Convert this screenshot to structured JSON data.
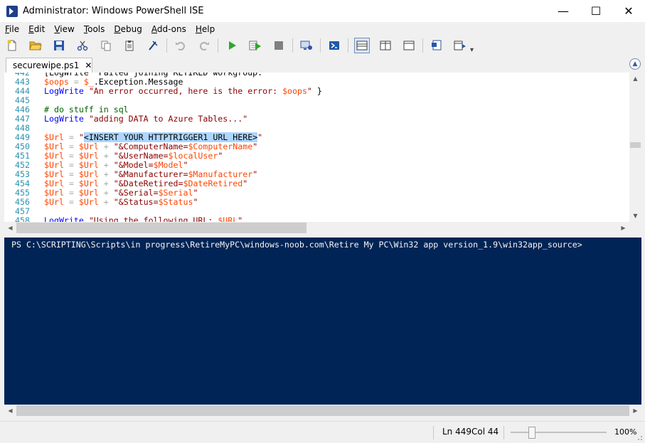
{
  "window": {
    "title": "Administrator: Windows PowerShell ISE",
    "minimize": "—",
    "maximize": "☐",
    "close": "✕"
  },
  "menu": [
    "File",
    "Edit",
    "View",
    "Tools",
    "Debug",
    "Add-ons",
    "Help"
  ],
  "toolbar": {
    "buttons": [
      "new-script",
      "open",
      "save",
      "cut",
      "copy",
      "paste",
      "clear-console",
      "undo",
      "redo",
      "run-script",
      "run-selection",
      "stop",
      "new-remote-tab",
      "start-powershell",
      "show-script-top",
      "show-script-right",
      "show-script-maximized",
      "show-commands",
      "show-command-addon"
    ],
    "overflow": "▾"
  },
  "tabs": [
    {
      "label": "securewipe.ps1",
      "close": "✕"
    }
  ],
  "collapse_glyph": "▲",
  "editor": {
    "lines": [
      {
        "n": "442",
        "tokens": [
          [
            "plain",
            "[LogWrite \"Failed joining RETIRED workgroup.\""
          ]
        ]
      },
      {
        "n": "443",
        "tokens": [
          [
            "var",
            "$oops"
          ],
          [
            "op",
            " = "
          ],
          [
            "var",
            "$_"
          ],
          [
            "plain",
            ".Exception.Message"
          ]
        ]
      },
      {
        "n": "444",
        "tokens": [
          [
            "cmd",
            "LogWrite"
          ],
          [
            "plain",
            " "
          ],
          [
            "str",
            "\"An error occurred, here is the error: "
          ],
          [
            "var",
            "$oops"
          ],
          [
            "str",
            "\""
          ],
          [
            "plain",
            " }"
          ]
        ]
      },
      {
        "n": "445",
        "tokens": []
      },
      {
        "n": "446",
        "tokens": [
          [
            "cmt",
            "# do stuff in sql"
          ]
        ]
      },
      {
        "n": "447",
        "tokens": [
          [
            "cmd",
            "LogWrite"
          ],
          [
            "plain",
            " "
          ],
          [
            "str",
            "\"adding DATA to Azure Tables...\""
          ]
        ]
      },
      {
        "n": "448",
        "tokens": []
      },
      {
        "n": "449",
        "tokens": [
          [
            "var",
            "$Url"
          ],
          [
            "op",
            " = "
          ],
          [
            "str",
            "\""
          ],
          [
            "sel",
            "<INSERT YOUR HTTPTRIGGER1 URL HERE>"
          ],
          [
            "str",
            "\""
          ]
        ]
      },
      {
        "n": "450",
        "tokens": [
          [
            "var",
            "$Url"
          ],
          [
            "op",
            " = "
          ],
          [
            "var",
            "$Url"
          ],
          [
            "op",
            " + "
          ],
          [
            "str",
            "\"&ComputerName="
          ],
          [
            "var",
            "$ComputerName"
          ],
          [
            "str",
            "\""
          ]
        ]
      },
      {
        "n": "451",
        "tokens": [
          [
            "var",
            "$Url"
          ],
          [
            "op",
            " = "
          ],
          [
            "var",
            "$Url"
          ],
          [
            "op",
            " + "
          ],
          [
            "str",
            "\"&UserName="
          ],
          [
            "var",
            "$localUser"
          ],
          [
            "str",
            "\""
          ]
        ]
      },
      {
        "n": "452",
        "tokens": [
          [
            "var",
            "$Url"
          ],
          [
            "op",
            " = "
          ],
          [
            "var",
            "$Url"
          ],
          [
            "op",
            " + "
          ],
          [
            "str",
            "\"&Model="
          ],
          [
            "var",
            "$Model"
          ],
          [
            "str",
            "\""
          ]
        ]
      },
      {
        "n": "453",
        "tokens": [
          [
            "var",
            "$Url"
          ],
          [
            "op",
            " = "
          ],
          [
            "var",
            "$Url"
          ],
          [
            "op",
            " + "
          ],
          [
            "str",
            "\"&Manufacturer="
          ],
          [
            "var",
            "$Manufacturer"
          ],
          [
            "str",
            "\""
          ]
        ]
      },
      {
        "n": "454",
        "tokens": [
          [
            "var",
            "$Url"
          ],
          [
            "op",
            " = "
          ],
          [
            "var",
            "$Url"
          ],
          [
            "op",
            " + "
          ],
          [
            "str",
            "\"&DateRetired="
          ],
          [
            "var",
            "$DateRetired"
          ],
          [
            "str",
            "\""
          ]
        ]
      },
      {
        "n": "455",
        "tokens": [
          [
            "var",
            "$Url"
          ],
          [
            "op",
            " = "
          ],
          [
            "var",
            "$Url"
          ],
          [
            "op",
            " + "
          ],
          [
            "str",
            "\"&Serial="
          ],
          [
            "var",
            "$Serial"
          ],
          [
            "str",
            "\""
          ]
        ]
      },
      {
        "n": "456",
        "tokens": [
          [
            "var",
            "$Url"
          ],
          [
            "op",
            " = "
          ],
          [
            "var",
            "$Url"
          ],
          [
            "op",
            " + "
          ],
          [
            "str",
            "\"&Status="
          ],
          [
            "var",
            "$Status"
          ],
          [
            "str",
            "\""
          ]
        ]
      },
      {
        "n": "457",
        "tokens": []
      },
      {
        "n": "458",
        "tokens": [
          [
            "cmd",
            "LogWrite"
          ],
          [
            "plain",
            " "
          ],
          [
            "str",
            "\"Using the following URL: "
          ],
          [
            "var",
            "$URL"
          ],
          [
            "str",
            "\""
          ]
        ]
      }
    ]
  },
  "scroll": {
    "up": "▲",
    "down": "▼",
    "left": "◀",
    "right": "▶"
  },
  "console": {
    "prompt": "PS C:\\SCRIPTING\\Scripts\\in progress\\RetireMyPC\\windows-noob.com\\Retire My PC\\Win32 app version_1.9\\win32app_source>"
  },
  "status": {
    "line": "Ln 449",
    "col": "Col 44",
    "zoom": "100%",
    "zoom_level": 0.2
  }
}
